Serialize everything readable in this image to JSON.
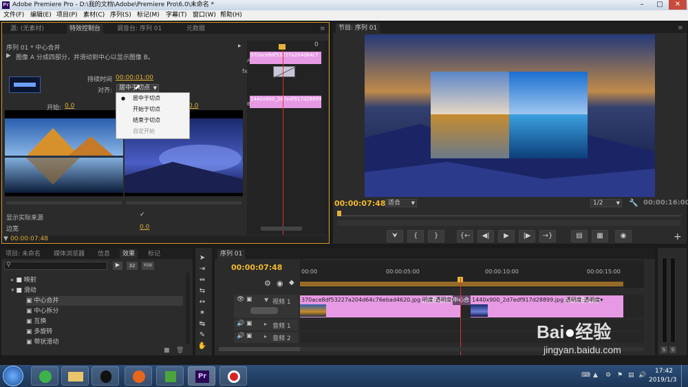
{
  "window": {
    "title": "Adobe Premiere Pro - D:\\我的文档\\Adobe\\Premiere Pro\\6.0\\未命名 *"
  },
  "menu": [
    "文件(F)",
    "编辑(E)",
    "项目(P)",
    "素材(C)",
    "序列(S)",
    "标记(M)",
    "字幕(T)",
    "窗口(W)",
    "帮助(H)"
  ],
  "effect_controls": {
    "tabs": [
      "源: (无素材)",
      "特效控制台",
      "调音台: 序列 01",
      "元数据"
    ],
    "header": "序列 01 * 中心合并",
    "description": "图像 A 分成四部分，并滑动到中心以显示图像 B。",
    "duration_label": "持续时间",
    "duration_value": "00:00:01:00",
    "align_label": "对齐:",
    "align_value": "居中于切点",
    "start_label": "开始:",
    "start_value": "0.0",
    "end_value": "0.0",
    "show_actual_sources": "显示实际来源",
    "border_label": "边宽",
    "border_value": "0.0",
    "timecode": "00:00:07:48",
    "mini_timeline_zero": "0",
    "track_a": "A",
    "track_b": "B",
    "clip_a": "370ace8df53227a204d64c7",
    "clip_b": "1440x900_2d7edf917d28899",
    "fx": "fx"
  },
  "align_menu": {
    "items": [
      {
        "label": "居中于切点",
        "checked": true,
        "enabled": true
      },
      {
        "label": "开始于切点",
        "checked": false,
        "enabled": true
      },
      {
        "label": "结束于切点",
        "checked": false,
        "enabled": true
      },
      {
        "label": "自定开始",
        "checked": false,
        "enabled": false
      }
    ]
  },
  "program_monitor": {
    "tab": "节目: 序列 01",
    "current_time": "00:00:07:48",
    "fit": "适合",
    "resolution": "1/2",
    "duration": "00:00:16:00"
  },
  "project_panel": {
    "tabs": [
      "项目: 未命名",
      "媒体浏览器",
      "信息",
      "效果",
      "标记"
    ],
    "tree": [
      {
        "label": "映射",
        "type": "folder",
        "expanded": false
      },
      {
        "label": "滑动",
        "type": "folder",
        "expanded": true
      },
      {
        "label": "中心合并",
        "type": "item"
      },
      {
        "label": "中心拆分",
        "type": "item"
      },
      {
        "label": "互换",
        "type": "item"
      },
      {
        "label": "多旋转",
        "type": "item"
      },
      {
        "label": "带状滑动",
        "type": "item"
      }
    ],
    "preset_badges": [
      "32",
      "YUV"
    ]
  },
  "timeline": {
    "tab": "序列 01",
    "timecode": "00:00:07:48",
    "ruler": [
      "00:00",
      "00:00:05:00",
      "00:00:10:00",
      "00:00:15:00"
    ],
    "tracks": [
      {
        "name": "视频 1",
        "type": "video"
      },
      {
        "name": "音频 1",
        "type": "audio"
      },
      {
        "name": "音频 2",
        "type": "audio"
      }
    ],
    "clip1": "370ace8df53227a204d64c76ebad4620.jpg",
    "clip1_fx": "明度:透明度",
    "transition": "中心合",
    "clip2": "1440x900_2d7edf917d28899.jpg",
    "clip2_fx": "透明度:透明度"
  },
  "audio_meter": {
    "solo": [
      "S",
      "S"
    ]
  },
  "taskbar": {
    "time": "17:42",
    "date": "2019/1/3"
  },
  "watermark": {
    "text": "Bai  经验",
    "url": "jingyan.baidu.com"
  }
}
